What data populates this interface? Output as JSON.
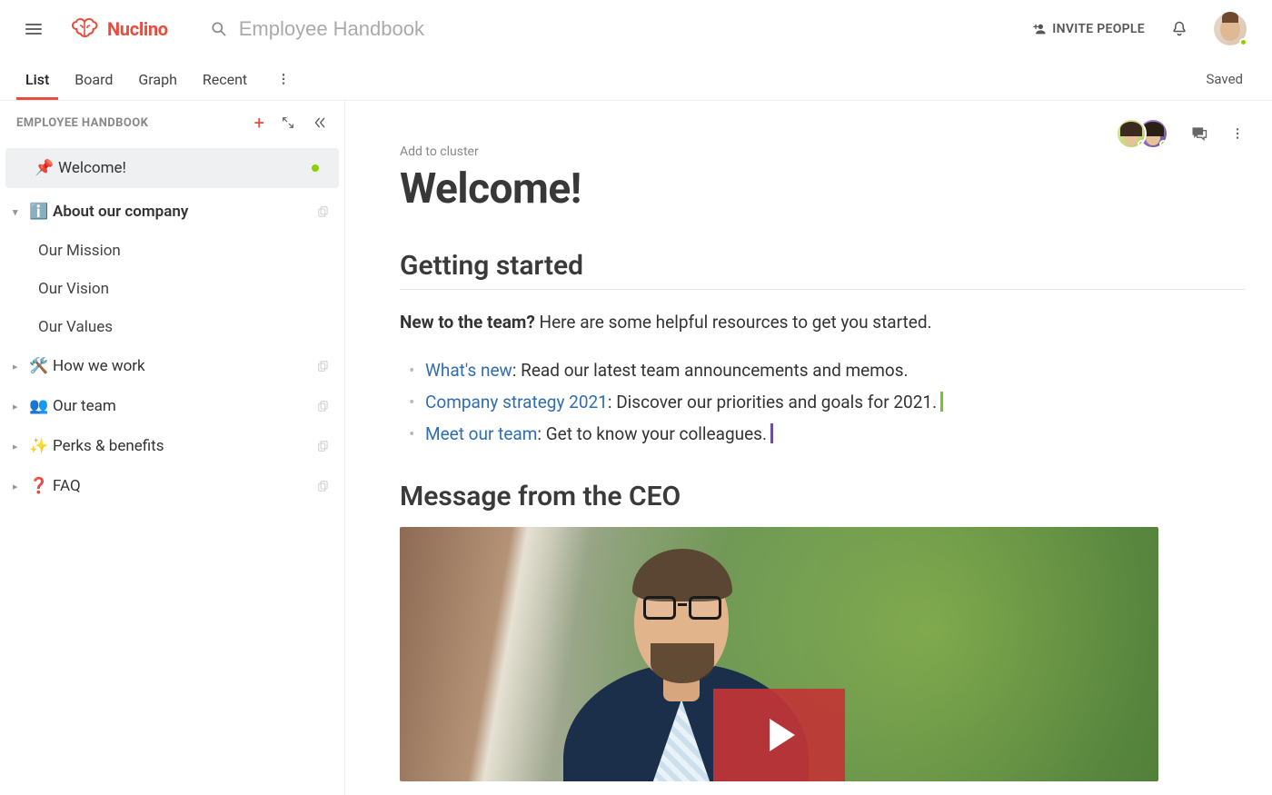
{
  "brand": {
    "name": "Nuclino"
  },
  "header": {
    "search_placeholder": "Employee Handbook",
    "invite_label": "INVITE PEOPLE",
    "saved_label": "Saved"
  },
  "view_tabs": {
    "list": "List",
    "board": "Board",
    "graph": "Graph",
    "recent": "Recent"
  },
  "sidebar": {
    "workspace_name": "EMPLOYEE HANDBOOK",
    "items": [
      {
        "emoji": "📌",
        "label": "Welcome!",
        "selected": true,
        "presence": true
      },
      {
        "emoji": "ℹ️",
        "label": "About our company",
        "expandable": true,
        "expanded": true,
        "children": [
          {
            "label": "Our Mission"
          },
          {
            "label": "Our Vision"
          },
          {
            "label": "Our Values"
          }
        ]
      },
      {
        "emoji": "🛠️",
        "label": "How we work",
        "expandable": true
      },
      {
        "emoji": "👥",
        "label": "Our team",
        "expandable": true
      },
      {
        "emoji": "✨",
        "label": "Perks & benefits",
        "expandable": true
      },
      {
        "emoji": "❓",
        "label": "FAQ",
        "expandable": true
      }
    ]
  },
  "page": {
    "cluster_hint": "Add to cluster",
    "title": "Welcome!",
    "section1_title": "Getting started",
    "intro_bold": "New to the team?",
    "intro_rest": " Here are some helpful resources to get you started.",
    "links": [
      {
        "text": "What's new",
        "tail": ": Read our latest team announcements and memos."
      },
      {
        "text": "Company strategy 2021",
        "tail": ": Discover our priorities and goals for 2021.",
        "cursor": "green"
      },
      {
        "text": "Meet our team",
        "tail": ": Get to know your colleagues.",
        "cursor": "purple"
      }
    ],
    "section2_title": "Message from the CEO"
  }
}
